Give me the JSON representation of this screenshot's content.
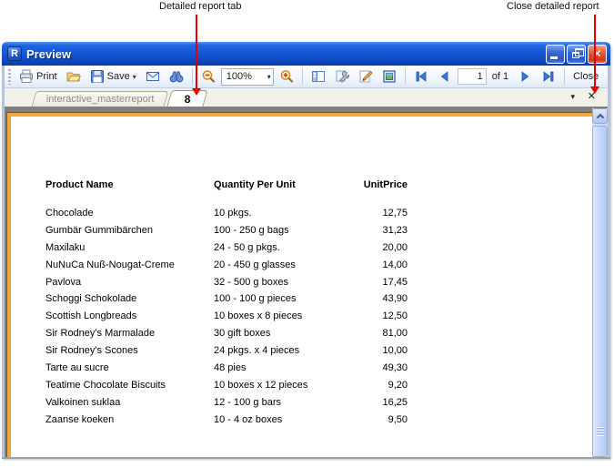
{
  "annotations": {
    "left_label": "Detailed report tab",
    "right_label": "Close detailed report",
    "line_color": "#e60000"
  },
  "window": {
    "title": "Preview",
    "icon_letter": "R",
    "titlebar_color": "#1557d6",
    "close_button_color": "#d8452a"
  },
  "toolbar": {
    "print_label": "Print",
    "save_label": "Save",
    "save_dropdown_glyph": "▾",
    "zoom_value": "100%",
    "zoom_dropdown_glyph": "▾",
    "page_current": "1",
    "page_of_label": "of 1",
    "close_label": "Close"
  },
  "tabstrip": {
    "tabs": [
      {
        "label": "interactive_masterreport",
        "active": false
      },
      {
        "label": "8",
        "active": true
      }
    ],
    "dropdown_glyph": "▾",
    "close_glyph": "✕"
  },
  "report": {
    "columns": [
      "Product Name",
      "Quantity Per Unit",
      "UnitPrice"
    ],
    "rows": [
      [
        "Chocolade",
        "10 pkgs.",
        "12,75"
      ],
      [
        "Gumbär Gummibärchen",
        "100 - 250 g bags",
        "31,23"
      ],
      [
        "Maxilaku",
        "24 - 50 g pkgs.",
        "20,00"
      ],
      [
        "NuNuCa Nuß-Nougat-Creme",
        "20 - 450 g glasses",
        "14,00"
      ],
      [
        "Pavlova",
        "32 - 500 g boxes",
        "17,45"
      ],
      [
        "Schoggi Schokolade",
        "100 - 100 g pieces",
        "43,90"
      ],
      [
        "Scottish Longbreads",
        "10 boxes x 8 pieces",
        "12,50"
      ],
      [
        "Sir Rodney's Marmalade",
        "30 gift boxes",
        "81,00"
      ],
      [
        "Sir Rodney's Scones",
        "24 pkgs. x 4 pieces",
        "10,00"
      ],
      [
        "Tarte au sucre",
        "48 pies",
        "49,30"
      ],
      [
        "Teatime Chocolate Biscuits",
        "10 boxes x 12 pieces",
        "9,20"
      ],
      [
        "Valkoinen suklaa",
        "12 - 100 g bars",
        "16,25"
      ],
      [
        "Zaanse koeken",
        "10 - 4 oz boxes",
        "9,50"
      ]
    ]
  },
  "colors": {
    "preview_background": "#7f7f7f",
    "page_border_yellow": "#f2a63b",
    "nav_arrow_blue": "#3b79dc",
    "annotation_red": "#e60000"
  }
}
